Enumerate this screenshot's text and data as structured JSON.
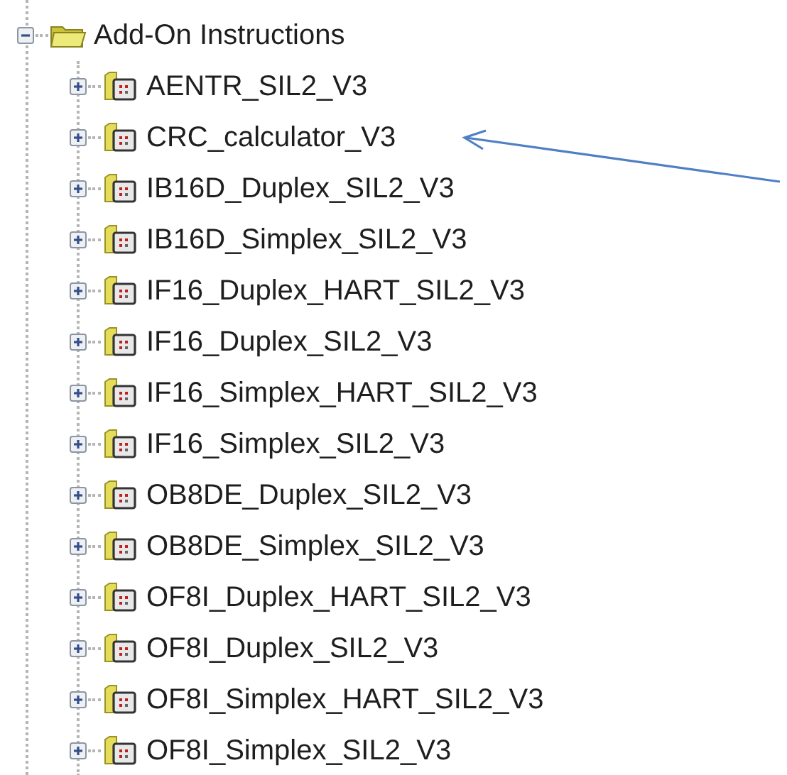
{
  "tree": {
    "label": "Add-On Instructions",
    "expanded": true,
    "children": [
      {
        "label": "AENTR_SIL2_V3",
        "expanded": false
      },
      {
        "label": "CRC_calculator_V3",
        "expanded": false
      },
      {
        "label": "IB16D_Duplex_SIL2_V3",
        "expanded": false
      },
      {
        "label": "IB16D_Simplex_SIL2_V3",
        "expanded": false
      },
      {
        "label": "IF16_Duplex_HART_SIL2_V3",
        "expanded": false
      },
      {
        "label": "IF16_Duplex_SIL2_V3",
        "expanded": false
      },
      {
        "label": "IF16_Simplex_HART_SIL2_V3",
        "expanded": false
      },
      {
        "label": "IF16_Simplex_SIL2_V3",
        "expanded": false
      },
      {
        "label": "OB8DE_Duplex_SIL2_V3",
        "expanded": false
      },
      {
        "label": "OB8DE_Simplex_SIL2_V3",
        "expanded": false
      },
      {
        "label": "OF8I_Duplex_HART_SIL2_V3",
        "expanded": false
      },
      {
        "label": "OF8I_Duplex_SIL2_V3",
        "expanded": false
      },
      {
        "label": "OF8I_Simplex_HART_SIL2_V3",
        "expanded": false
      },
      {
        "label": "OF8I_Simplex_SIL2_V3",
        "expanded": false
      }
    ]
  }
}
